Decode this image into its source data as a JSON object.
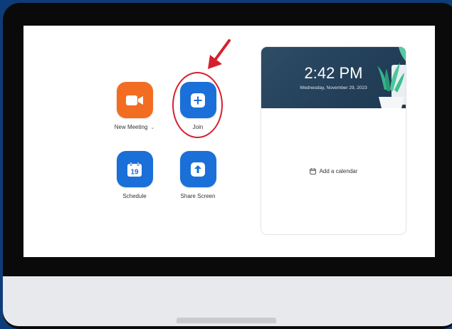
{
  "home": {
    "new_meeting": {
      "label": "New Meeting",
      "icon": "video-camera-icon"
    },
    "join": {
      "label": "Join",
      "icon": "plus-icon"
    },
    "schedule": {
      "label": "Schedule",
      "icon": "calendar-icon",
      "day": "19"
    },
    "share_screen": {
      "label": "Share Screen",
      "icon": "arrow-up-icon"
    }
  },
  "calendar_card": {
    "time": "2:42 PM",
    "date": "Wednesday, November 29, 2023",
    "add_calendar_label": "Add a calendar"
  },
  "colors": {
    "accent_blue": "#1a6fd9",
    "new_meeting_orange": "#f26d21",
    "annotation_red": "#d6202e"
  }
}
